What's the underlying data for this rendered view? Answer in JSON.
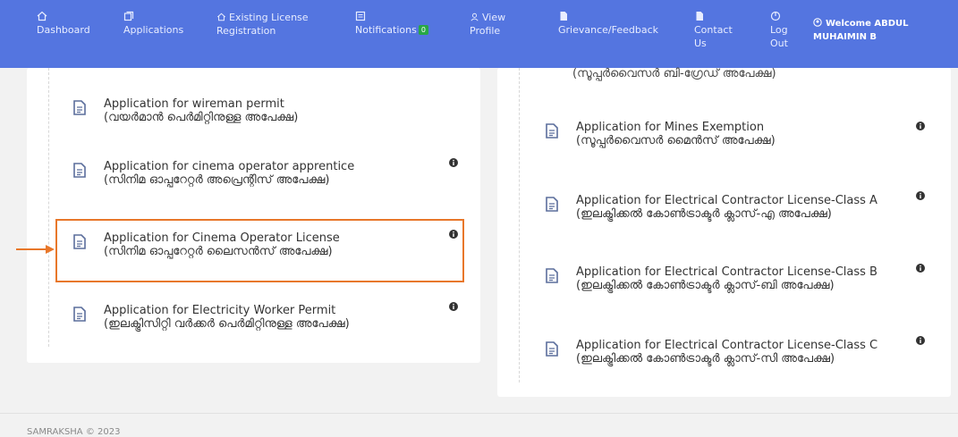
{
  "nav": {
    "items": [
      {
        "id": "dashboard",
        "icon": "home-icon",
        "lines": [
          "",
          "Dashboard"
        ]
      },
      {
        "id": "applications",
        "icon": "copy-icon",
        "lines": [
          "",
          "Applications"
        ]
      },
      {
        "id": "existing-license",
        "icon": "home-icon",
        "lines": [
          "Existing License",
          "Registration"
        ]
      },
      {
        "id": "notifications",
        "icon": "list-icon",
        "lines": [
          "",
          "Notifications"
        ],
        "badge": "0"
      },
      {
        "id": "view-profile",
        "icon": "user-icon",
        "lines": [
          "View",
          "Profile"
        ]
      },
      {
        "id": "grievance",
        "icon": "file-icon",
        "lines": [
          "",
          "Grievance/Feedback"
        ]
      },
      {
        "id": "contact-us",
        "icon": "file-icon",
        "lines": [
          "",
          "Contact",
          "Us"
        ]
      },
      {
        "id": "log-out",
        "icon": "power-icon",
        "lines": [
          "",
          "Log",
          "Out"
        ]
      }
    ],
    "welcome_line1": "Welcome ABDUL",
    "welcome_line2": "MUHAIMIN B"
  },
  "left_apps": [
    {
      "title": "Application for wireman permit",
      "subtitle": "(വയർമാൻ പെർമിറ്റിനുള്ള അപേക്ഷ)",
      "info": false
    },
    {
      "title": "Application for cinema operator apprentice",
      "subtitle": "(സിനിമ ഓപ്പറേറ്റർ അപ്രെന്റിസ് അപേക്ഷ)",
      "info": true
    },
    {
      "title": "Application for Cinema Operator License",
      "subtitle": "(സിനിമ ഓപ്പറേറ്റർ ലൈസൻസ് അപേക്ഷ)",
      "info": true,
      "highlighted": true
    },
    {
      "title": "Application for Electricity Worker Permit",
      "subtitle": "(ഇലക്ട്രിസിറ്റി വർക്കർ പെർമിറ്റിനുള്ള അപേക്ഷ)",
      "info": true
    }
  ],
  "right_top_cut": "(സൂപ്പർവൈസർ ബി-ഗ്രേഡ് അപേക്ഷ)",
  "right_apps": [
    {
      "title": "Application for Mines Exemption",
      "subtitle": "(സൂപ്പർവൈസർ മൈൻസ് അപേക്ഷ)",
      "info": true
    },
    {
      "title": "Application for Electrical Contractor License-Class A",
      "subtitle": "(ഇലക്ട്രിക്കൽ കോൺട്രാക്ടർ ക്ലാസ്-എ അപേക്ഷ)",
      "info": true
    },
    {
      "title": "Application for Electrical Contractor License-Class B",
      "subtitle": "(ഇലക്ട്രിക്കൽ കോൺട്രാക്ടർ ക്ലാസ്-ബി അപേക്ഷ)",
      "info": true
    },
    {
      "title": "Application for Electrical Contractor License-Class C",
      "subtitle": "(ഇലക്ട്രിക്കൽ കോൺട്രാക്ടർ ക്ലാസ്-സി അപേക്ഷ)",
      "info": true
    }
  ],
  "footer": {
    "text": "SAMRAKSHA © 2023"
  },
  "colors": {
    "nav_bg": "#5475e0",
    "highlight": "#e8772a",
    "badge": "#28a745",
    "icon": "#5b6e9c"
  }
}
